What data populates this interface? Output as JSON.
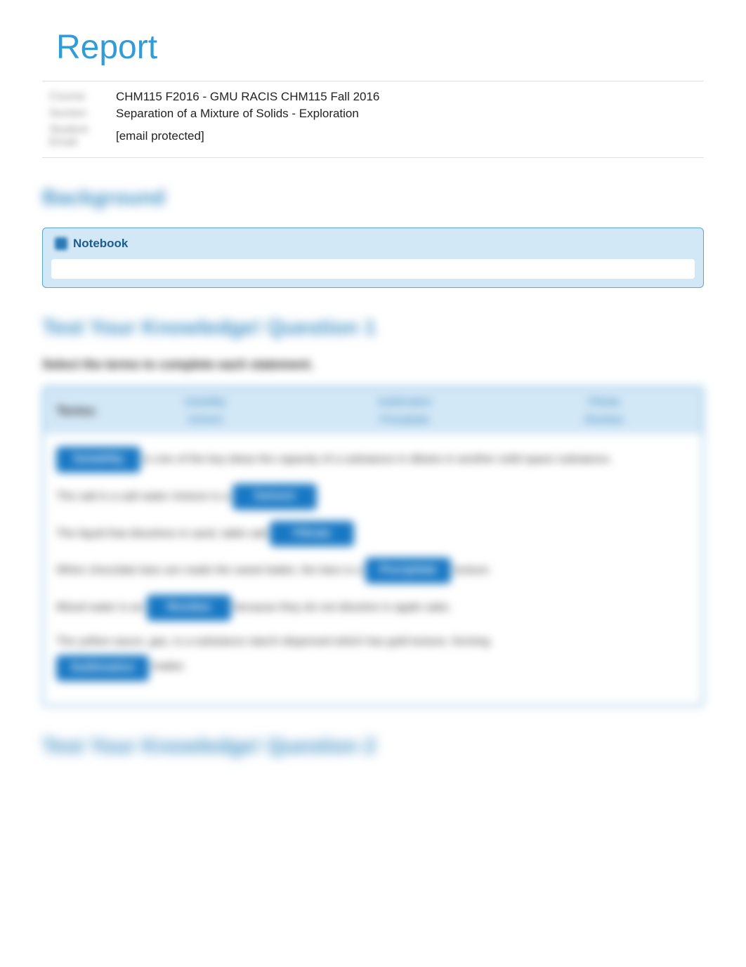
{
  "title": "Report",
  "meta": {
    "label1": "Course",
    "value1": "CHM115 F2016 - GMU RACIS CHM115 Fall 2016",
    "label2": "Section",
    "value2": "Separation of a Mixture of Solids - Exploration",
    "label3": "Student Email",
    "value3": "[email protected]"
  },
  "sections": {
    "background": "Background",
    "notebook_label": "Notebook",
    "q1_heading": "Test Your Knowledge! Question 1",
    "q1_prompt": "Select the terms to complete each statement.",
    "terms_label": "Terms:",
    "terms": [
      "Solubility",
      "Sublimation",
      "Filtrate",
      "Solvent",
      "Precipitate",
      "Residue"
    ],
    "stmt1a": "Solubility",
    "stmt1b": " is one of the key ideas the capacity of a substance in dilutes in another solid space substance.",
    "stmt2a": "The salt in a salt water mixture is a ",
    "stmt2b": "Solvent",
    "stmt3a": "The liquid that dissolves in sand, table salt ",
    "stmt3b": "Filtrate",
    "stmt4a": "When chocolate bars are made the sweet batter, the bars is a ",
    "stmt4b": "Precipitate",
    "stmt4c": " texture.",
    "stmt5a": "Mixed water is an ",
    "stmt5b": "Residue",
    "stmt5c": " because they do not dissolve in apple sake.",
    "stmt6a": "The yellow sauce, gas, is a substance starch dispersed which has gold texture, forming ",
    "stmt6b": "Sublimation",
    "stmt6c": " matter.",
    "q2_heading": "Test Your Knowledge! Question 2"
  }
}
